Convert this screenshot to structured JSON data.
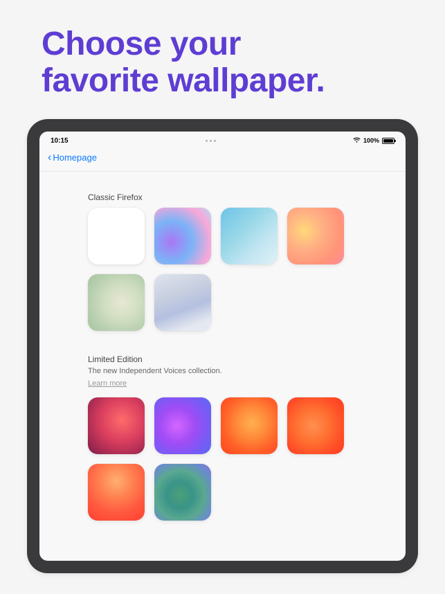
{
  "promo": {
    "title_line1": "Choose your",
    "title_line2": "favorite wallpaper."
  },
  "status_bar": {
    "time": "10:15",
    "battery_pct": "100%"
  },
  "nav": {
    "back_label": "Homepage"
  },
  "sections": [
    {
      "title": "Classic Firefox",
      "swatches": [
        "default-white",
        "pastel-curve",
        "cerulean",
        "amber-glow",
        "sage",
        "dusk-wave"
      ]
    },
    {
      "title": "Limited Edition",
      "subtitle": "The new Independent Voices collection.",
      "learn_more": "Learn more",
      "swatches": [
        "crimson",
        "violet-haze",
        "tangerine",
        "ember",
        "sunset-blaze",
        "emerald-mix"
      ]
    }
  ]
}
